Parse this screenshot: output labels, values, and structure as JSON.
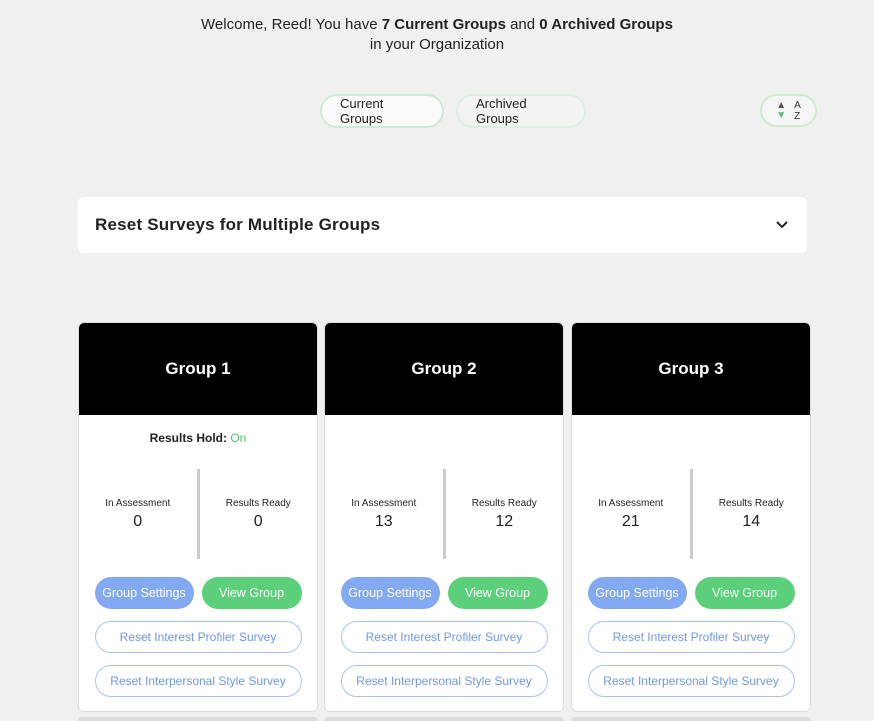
{
  "welcome": {
    "prefix": "Welcome, Reed! You have ",
    "current_count": "7 Current Groups",
    "middle": " and ",
    "archived_count": "0 Archived Groups",
    "line2": "in your Organization"
  },
  "tabs": {
    "current": "Current Groups",
    "archived": "Archived Groups"
  },
  "sort": {
    "letter_top": "A",
    "letter_bottom": "Z"
  },
  "reset_panel": {
    "title": "Reset Surveys for Multiple Groups"
  },
  "groups": [
    {
      "name": "Group 1",
      "hold_label": "Results Hold:",
      "hold_value": "On",
      "in_assessment_label": "In Assessment",
      "in_assessment": "0",
      "results_ready_label": "Results Ready",
      "results_ready": "0",
      "settings_label": "Group Settings",
      "view_label": "View Group",
      "reset_interest": "Reset Interest Profiler Survey",
      "reset_interpersonal": "Reset Interpersonal Style Survey"
    },
    {
      "name": "Group 2",
      "in_assessment_label": "In Assessment",
      "in_assessment": "13",
      "results_ready_label": "Results Ready",
      "results_ready": "12",
      "settings_label": "Group Settings",
      "view_label": "View Group",
      "reset_interest": "Reset Interest Profiler Survey",
      "reset_interpersonal": "Reset Interpersonal Style Survey"
    },
    {
      "name": "Group 3",
      "in_assessment_label": "In Assessment",
      "in_assessment": "21",
      "results_ready_label": "Results Ready",
      "results_ready": "14",
      "settings_label": "Group Settings",
      "view_label": "View Group",
      "reset_interest": "Reset Interest Profiler Survey",
      "reset_interpersonal": "Reset Interpersonal Style Survey"
    }
  ],
  "colors": {
    "accent_green": "#5bcf7a",
    "accent_blue": "#84a9f3",
    "outline_blue": "#6f98e9",
    "card_header": "#000000"
  },
  "icons": {
    "sort": "sort-az-icon",
    "expand": "chevron-down-icon"
  }
}
